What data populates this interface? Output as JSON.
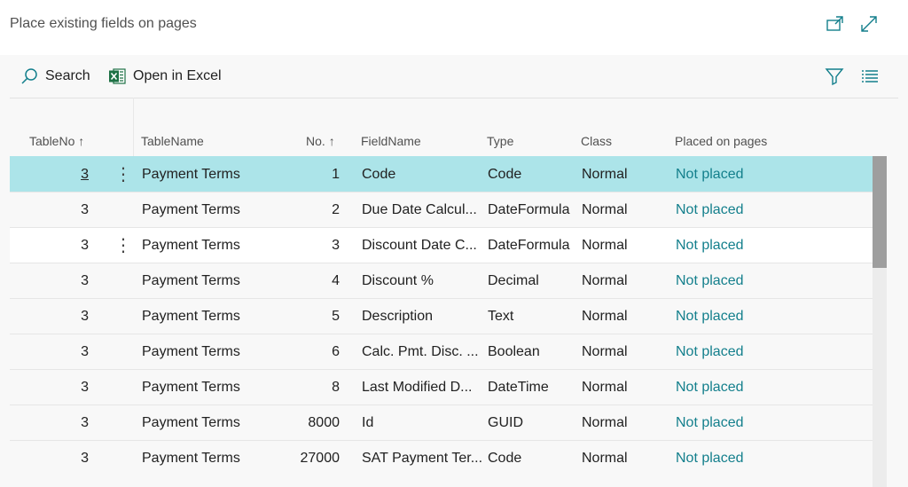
{
  "page": {
    "title": "Place existing fields on pages"
  },
  "header_icons": {
    "open_new_window": "open-in-new-window-icon",
    "expand": "expand-icon"
  },
  "toolbar": {
    "search_label": "Search",
    "excel_label": "Open in Excel",
    "icons": {
      "search": "search-icon",
      "excel": "excel-icon",
      "filter": "filter-icon",
      "list": "list-view-icon"
    }
  },
  "colors": {
    "selected_row": "#ace4e9",
    "link": "#137f8c",
    "accent_icon": "#137f8c",
    "excel_green": "#1e7145"
  },
  "columns": {
    "table_no": "TableNo",
    "table_no_sort": "↑",
    "table_name": "TableName",
    "no": "No.",
    "no_sort": "↑",
    "field_name": "FieldName",
    "type": "Type",
    "class": "Class",
    "placed": "Placed on pages"
  },
  "rows": [
    {
      "table_no": "3",
      "table_name": "Payment Terms",
      "no": "1",
      "field_name": "Code",
      "type": "Code",
      "class": "Normal",
      "placed": "Not placed"
    },
    {
      "table_no": "3",
      "table_name": "Payment Terms",
      "no": "2",
      "field_name": "Due Date Calcul...",
      "type": "DateFormula",
      "class": "Normal",
      "placed": "Not placed"
    },
    {
      "table_no": "3",
      "table_name": "Payment Terms",
      "no": "3",
      "field_name": "Discount Date C...",
      "type": "DateFormula",
      "class": "Normal",
      "placed": "Not placed"
    },
    {
      "table_no": "3",
      "table_name": "Payment Terms",
      "no": "4",
      "field_name": "Discount %",
      "type": "Decimal",
      "class": "Normal",
      "placed": "Not placed"
    },
    {
      "table_no": "3",
      "table_name": "Payment Terms",
      "no": "5",
      "field_name": "Description",
      "type": "Text",
      "class": "Normal",
      "placed": "Not placed"
    },
    {
      "table_no": "3",
      "table_name": "Payment Terms",
      "no": "6",
      "field_name": "Calc. Pmt. Disc. ...",
      "type": "Boolean",
      "class": "Normal",
      "placed": "Not placed"
    },
    {
      "table_no": "3",
      "table_name": "Payment Terms",
      "no": "8",
      "field_name": "Last Modified D...",
      "type": "DateTime",
      "class": "Normal",
      "placed": "Not placed"
    },
    {
      "table_no": "3",
      "table_name": "Payment Terms",
      "no": "8000",
      "field_name": "Id",
      "type": "GUID",
      "class": "Normal",
      "placed": "Not placed"
    },
    {
      "table_no": "3",
      "table_name": "Payment Terms",
      "no": "27000",
      "field_name": "SAT Payment Ter...",
      "type": "Code",
      "class": "Normal",
      "placed": "Not placed"
    }
  ],
  "row_actions_glyph": "⋮"
}
